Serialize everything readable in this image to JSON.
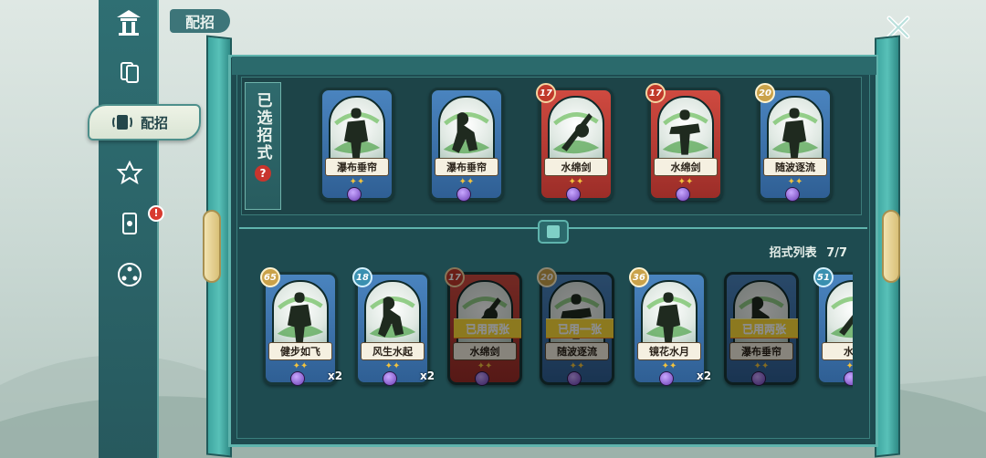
{
  "header": {
    "title": "配招"
  },
  "sidebar": {
    "active_label": "配招",
    "alert_badge": "!"
  },
  "selected": {
    "label": "已选招式",
    "help": "?",
    "cards": [
      {
        "name": "瀑布垂帘",
        "color": "blue",
        "level": ""
      },
      {
        "name": "瀑布垂帘",
        "color": "blue",
        "level": ""
      },
      {
        "name": "水绵剑",
        "color": "red",
        "level": "17"
      },
      {
        "name": "水绵剑",
        "color": "red",
        "level": "17"
      },
      {
        "name": "随波逐流",
        "color": "blue",
        "level": "20"
      }
    ]
  },
  "list": {
    "header": "招式列表",
    "count": "7/7",
    "cards": [
      {
        "name": "健步如飞",
        "color": "blue",
        "level": "65",
        "level_style": "gold",
        "count": "x2",
        "used": "",
        "dim": false
      },
      {
        "name": "风生水起",
        "color": "blue",
        "level": "18",
        "level_style": "blue",
        "count": "x2",
        "used": "",
        "dim": false
      },
      {
        "name": "水绵剑",
        "color": "red",
        "level": "17",
        "level_style": "red",
        "count": "",
        "used": "已用两张",
        "dim": true
      },
      {
        "name": "随波逐流",
        "color": "blue",
        "level": "20",
        "level_style": "gold",
        "count": "",
        "used": "已用一张",
        "dim": true
      },
      {
        "name": "镜花水月",
        "color": "blue",
        "level": "36",
        "level_style": "gold",
        "count": "x2",
        "used": "",
        "dim": false
      },
      {
        "name": "瀑布垂帘",
        "color": "blue",
        "level": "",
        "level_style": "gold",
        "count": "",
        "used": "已用两张",
        "dim": true
      },
      {
        "name": "水漫",
        "color": "blue",
        "level": "51",
        "level_style": "blue",
        "count": "",
        "used": "",
        "dim": false
      }
    ]
  },
  "colors": {
    "panel": "#1e4b50",
    "accent": "#5fb4ad",
    "card_blue": "#4a84bf",
    "card_red": "#cf4a40",
    "used_badge": "#d47a1f"
  }
}
